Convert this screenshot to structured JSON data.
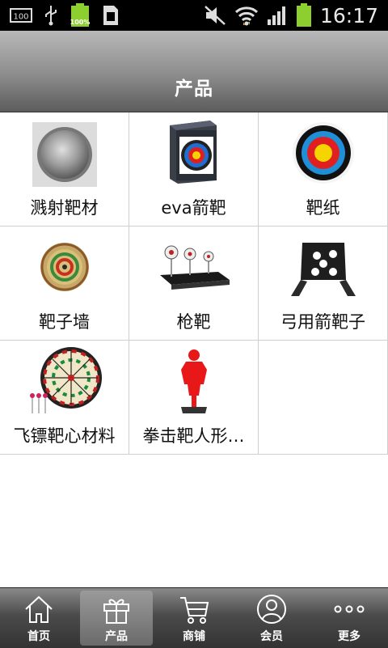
{
  "status_bar": {
    "battery_label": "100%",
    "storage_label": "100",
    "time": "16:17"
  },
  "header": {
    "title": "产品"
  },
  "products": [
    {
      "name": "溅射靶材",
      "icon": "sputtering-target-image"
    },
    {
      "name": "eva箭靶",
      "icon": "eva-arrow-target-image"
    },
    {
      "name": "靶纸",
      "icon": "target-paper-image"
    },
    {
      "name": "靶子墙",
      "icon": "straw-target-wall-image"
    },
    {
      "name": "枪靶",
      "icon": "gun-target-image"
    },
    {
      "name": "弓用箭靶子",
      "icon": "bow-arrow-target-image"
    },
    {
      "name": "飞镖靶心材料",
      "icon": "dartboard-image"
    },
    {
      "name": "拳击靶人形…",
      "icon": "boxing-dummy-image"
    }
  ],
  "tabs": [
    {
      "label": "首页",
      "icon": "home-icon",
      "active": false
    },
    {
      "label": "产品",
      "icon": "gift-icon",
      "active": true
    },
    {
      "label": "商铺",
      "icon": "cart-icon",
      "active": false
    },
    {
      "label": "会员",
      "icon": "user-icon",
      "active": false
    },
    {
      "label": "更多",
      "icon": "more-icon",
      "active": false
    }
  ],
  "colors": {
    "header_text": "#ffffff",
    "target_red": "#e02020",
    "target_blue": "#1f6fd0",
    "target_yellow": "#f6d400"
  }
}
